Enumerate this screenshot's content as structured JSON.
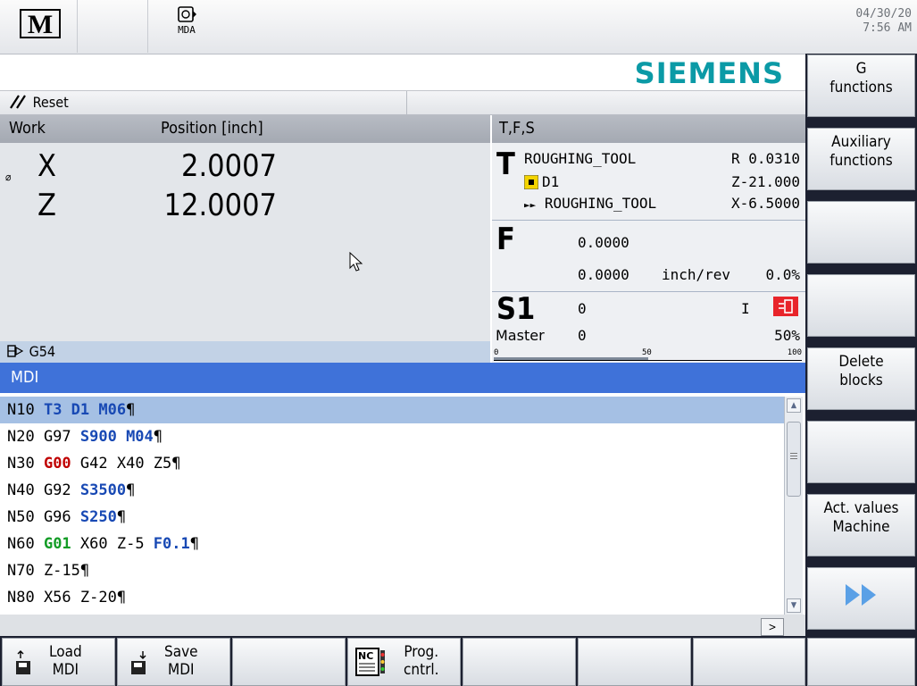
{
  "header": {
    "mode_label": "MDA",
    "date": "04/30/20",
    "time": "7:56 AM",
    "brand": "SIEMENS",
    "icons": [
      "machine-m-icon",
      "mda-icon"
    ]
  },
  "status": {
    "channel_state": "Reset"
  },
  "work_panel": {
    "col1": "Work",
    "col2": "Position [inch]",
    "axes": [
      {
        "name": "X",
        "value": "2.0007"
      },
      {
        "name": "Z",
        "value": "12.0007"
      }
    ],
    "frame": "G54"
  },
  "tfs_panel": {
    "title": "T,F,S",
    "tool_letter": "T",
    "tool_name": "ROUGHING_TOOL",
    "tool_radius": "R 0.0310",
    "d_number": "D1",
    "tool_z": "Z-21.000",
    "next_tool": "ROUGHING_TOOL",
    "tool_x": "X-6.5000",
    "feed_letter": "F",
    "feed_actual": "0.0000",
    "feed_set": "0.0000",
    "feed_unit": "inch/rev",
    "feed_override": "0.0%",
    "spindle_label": "S1",
    "spindle_actual": "0",
    "spindle_set": "0",
    "spindle_mode": "Master",
    "spindle_dir": "I",
    "spindle_override": "50%",
    "spindle_override_fraction": 0.5,
    "scale_labels": [
      "0",
      "50",
      "100"
    ]
  },
  "mdi": {
    "title": "MDI",
    "lines": [
      [
        {
          "t": "N10 ",
          "c": ""
        },
        {
          "t": "T3 D1 M06",
          "c": "blue"
        },
        {
          "t": "¶",
          "c": ""
        }
      ],
      [
        {
          "t": "N20 G97 ",
          "c": ""
        },
        {
          "t": "S900 M04",
          "c": "blue"
        },
        {
          "t": "¶",
          "c": ""
        }
      ],
      [
        {
          "t": "N30 ",
          "c": ""
        },
        {
          "t": "G00",
          "c": "red"
        },
        {
          "t": " G42 X40 Z5¶",
          "c": ""
        }
      ],
      [
        {
          "t": "N40 G92 ",
          "c": ""
        },
        {
          "t": "S3500",
          "c": "blue"
        },
        {
          "t": "¶",
          "c": ""
        }
      ],
      [
        {
          "t": "N50 G96 ",
          "c": ""
        },
        {
          "t": "S250",
          "c": "blue"
        },
        {
          "t": "¶",
          "c": ""
        }
      ],
      [
        {
          "t": "N60 ",
          "c": ""
        },
        {
          "t": "G01",
          "c": "green"
        },
        {
          "t": " X60 Z-5 ",
          "c": ""
        },
        {
          "t": "F0.1",
          "c": "blue"
        },
        {
          "t": "¶",
          "c": ""
        }
      ],
      [
        {
          "t": "N70 Z-15¶",
          "c": ""
        }
      ],
      [
        {
          "t": "N80 X56 Z-20¶",
          "c": ""
        }
      ]
    ]
  },
  "right_softkeys": [
    {
      "line1": "G",
      "line2": "functions"
    },
    {
      "line1": "Auxiliary",
      "line2": "functions"
    },
    {
      "line1": "",
      "line2": ""
    },
    {
      "line1": "",
      "line2": ""
    },
    {
      "line1": "Delete",
      "line2": "blocks"
    },
    {
      "line1": "",
      "line2": ""
    },
    {
      "line1": "Act. values",
      "line2": "Machine"
    },
    {
      "line1": "",
      "line2": ""
    }
  ],
  "bottom_softkeys": [
    {
      "line1": "Load",
      "line2": "MDI",
      "icon": "load-disk-icon"
    },
    {
      "line1": "Save",
      "line2": "MDI",
      "icon": "save-disk-icon"
    },
    {
      "line1": "",
      "line2": ""
    },
    {
      "line1": "Prog.",
      "line2": "cntrl.",
      "icon": "nc-program-icon"
    },
    {
      "line1": "",
      "line2": ""
    },
    {
      "line1": "",
      "line2": ""
    },
    {
      "line1": "",
      "line2": ""
    },
    {
      "line1": "",
      "line2": ""
    }
  ],
  "colors": {
    "brand": "#0b9aa6",
    "mdi_header": "#3f72d9",
    "selected_line": "#a5c0e4",
    "keyword_blue": "#1849b4",
    "keyword_red": "#c00000",
    "keyword_green": "#139c26",
    "spindle_alarm": "#e8242a"
  }
}
